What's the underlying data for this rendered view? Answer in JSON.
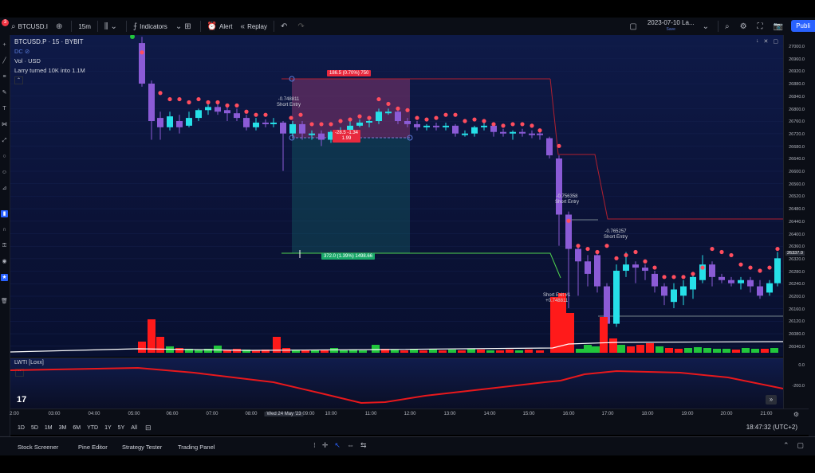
{
  "toolbar": {
    "notification_count": "3",
    "symbol": "BTCUSD.I",
    "interval": "15m",
    "indicators": "Indicators",
    "alert": "Alert",
    "replay": "Replay",
    "date_range": "2023-07-10 La...",
    "save": "Save",
    "publish": "Publi"
  },
  "legend": {
    "symbol_line": "BTCUSD.P · 15 · BYBIT",
    "dc": "DC",
    "vol": "Vol · USD",
    "strategy": "Larry turned 10K into 1.1M"
  },
  "annotations": {
    "entry1_value": "-0.748811",
    "entry1_label": "Short Entry",
    "entry2_value": "-0.756358",
    "entry2_label": "Short Entry",
    "entry3_value": "-0.765257",
    "entry3_label": "Short Entry",
    "exit_label": "Short Exit #1",
    "exit_value": "+0.748811",
    "stop_tag": "186.5 (0.70%) 750",
    "pnl_tag_line1": "-28.5 -1.34",
    "pnl_tag_line2": "1.99",
    "target_tag": "372.0 (1.39%) 1498.66"
  },
  "indicator": {
    "name": "LWTI [Loxx]",
    "level_0": "0.0",
    "level_200": "-200.0"
  },
  "price_axis": [
    "27000.0",
    "26960.0",
    "26920.0",
    "26880.0",
    "26840.0",
    "26800.0",
    "26760.0",
    "26720.0",
    "26680.0",
    "26640.0",
    "26600.0",
    "26560.0",
    "26520.0",
    "26480.0",
    "26440.0",
    "26400.0",
    "26360.0",
    "26320.0",
    "26280.0",
    "26240.0",
    "26200.0",
    "26160.0",
    "26120.0",
    "26080.0",
    "26040.0"
  ],
  "current_price": "26337.0",
  "time_axis": [
    "2:00",
    "03:00",
    "04:00",
    "05:00",
    "06:00",
    "07:00",
    "08:00",
    "Wed 24 May '23",
    "09:00",
    "10:00",
    "11:00",
    "12:00",
    "13:00",
    "14:00",
    "15:00",
    "16:00",
    "17:00",
    "18:00",
    "19:00",
    "20:00",
    "21:00"
  ],
  "ranges": [
    "1D",
    "5D",
    "1M",
    "3M",
    "6M",
    "YTD",
    "1Y",
    "5Y",
    "All"
  ],
  "clock": "18:47:32 (UTC+2)",
  "bottom_tabs": [
    "Stock Screener",
    "Pine Editor",
    "Strategy Tester",
    "Trading Panel"
  ],
  "colors": {
    "up": "#26e0e8",
    "down": "#8b5bd6",
    "dot": "#ff4d5e",
    "vol_up": "#21c63c",
    "vol_down": "#ff1a1a",
    "accent": "#2962ff"
  }
}
